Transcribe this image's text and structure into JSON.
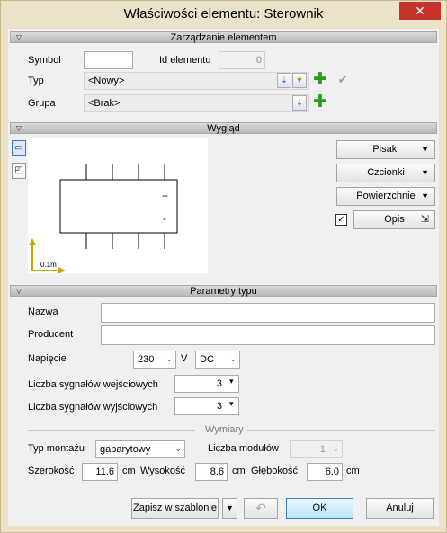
{
  "window": {
    "title": "Właściwości elementu: Sterownik",
    "close_glyph": "✕"
  },
  "sections": {
    "management": "Zarządzanie elementem",
    "appearance": "Wygląd",
    "type_params": "Parametry typu"
  },
  "management": {
    "symbol_label": "Symbol",
    "symbol_value": "",
    "id_label": "Id elementu",
    "id_value": "0",
    "type_label": "Typ",
    "type_value": "<Nowy>",
    "group_label": "Grupa",
    "group_value": "<Brak>"
  },
  "appearance": {
    "scale_label": "0.1m",
    "plus_sign": "+",
    "minus_sign": "-",
    "buttons": {
      "pens": "Pisaki",
      "fonts": "Czcionki",
      "surfaces": "Powierzchnie",
      "description": "Opis"
    },
    "description_checked": true
  },
  "type_params": {
    "name_label": "Nazwa",
    "name_value": "",
    "producer_label": "Producent",
    "producer_value": "",
    "voltage_label": "Napięcie",
    "voltage_value": "230",
    "voltage_unit": "V",
    "current_type": "DC",
    "inputs_label": "Liczba sygnałów wejściowych",
    "inputs_value": "3",
    "outputs_label": "Liczba sygnałów wyjściowych",
    "outputs_value": "3",
    "dimensions_label": "Wymiary",
    "mount_label": "Typ montażu",
    "mount_value": "gabarytowy",
    "modules_label": "Liczba modułów",
    "modules_value": "1",
    "width_label": "Szerokość",
    "width_value": "11.6",
    "height_label": "Wysokość",
    "height_value": "8.6",
    "depth_label": "Głębokość",
    "depth_value": "6.0",
    "unit": "cm"
  },
  "footer": {
    "save_template": "Zapisz w szablonie",
    "ok": "OK",
    "cancel": "Anuluj"
  },
  "colors": {
    "window_frame": "#ebe3c9",
    "close_button": "#c7322b",
    "section_header": "#c8c8c8",
    "green_plus": "#2a9b1b"
  }
}
